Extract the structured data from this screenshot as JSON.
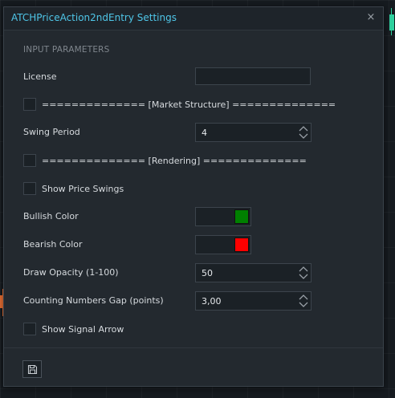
{
  "dialog": {
    "title": "ATCHPriceAction2ndEntry Settings",
    "close_glyph": "×",
    "section_label": "INPUT PARAMETERS"
  },
  "fields": {
    "license": {
      "label": "License",
      "value": ""
    },
    "market_structure": {
      "label": "============== [Market Structure] ==============",
      "checked": false
    },
    "swing_period": {
      "label": "Swing Period",
      "value": "4"
    },
    "rendering": {
      "label": "============== [Rendering] ==============",
      "checked": false
    },
    "show_price_swings": {
      "label": "Show Price Swings",
      "checked": false
    },
    "bullish_color": {
      "label": "Bullish Color",
      "color": "#008000"
    },
    "bearish_color": {
      "label": "Bearish Color",
      "color": "#ff0000"
    },
    "draw_opacity": {
      "label": "Draw Opacity (1-100)",
      "value": "50"
    },
    "counting_gap": {
      "label": "Counting Numbers Gap (points)",
      "value": "3,00"
    },
    "show_signal_arrow": {
      "label": "Show Signal Arrow",
      "checked": false
    }
  },
  "footer": {
    "save_icon": "save-icon"
  },
  "colors": {
    "accent": "#4fc6e8",
    "background": "#161b20",
    "panel": "#23292f",
    "bull_candle": "#2fd3a0",
    "bear_candle": "#f07335"
  }
}
